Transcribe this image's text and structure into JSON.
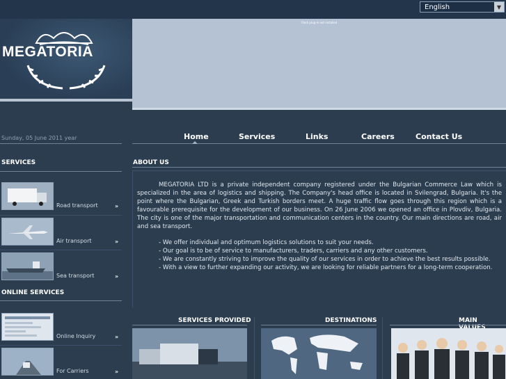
{
  "language": {
    "selected": "English"
  },
  "brand": {
    "name": "MEGATORIA"
  },
  "banner": {
    "message": "Flash plug-in not installed"
  },
  "date": "Sunday, 05 June 2011 year",
  "nav": [
    {
      "label": "Home"
    },
    {
      "label": "Services"
    },
    {
      "label": "Links"
    },
    {
      "label": "Careers"
    },
    {
      "label": "Contact Us"
    }
  ],
  "services": {
    "title": "SERVICES",
    "items": [
      {
        "label": "Road transport",
        "icon": "truck-photo"
      },
      {
        "label": "Air transport",
        "icon": "airplane-photo"
      },
      {
        "label": "Sea transport",
        "icon": "ship-photo"
      }
    ],
    "more_glyph": "»"
  },
  "online_services": {
    "title": "ONLINE SERVICES",
    "items": [
      {
        "label": "Online Inquiry",
        "icon": "form-screenshot"
      },
      {
        "label": "For Carriers",
        "icon": "road-photo"
      }
    ]
  },
  "about": {
    "title": "ABOUT US",
    "paragraph": "MEGATORIA LTD is a private independent company registered under the Bulgarian Commerce Law which is specialized in the area of logistics and shipping. The Company's head office is located in Svilengrad, Bulgaria. It's the point where the Bulgarian, Greek and Turkish borders meet. A huge traffic flow goes through this region which is a favourable prerequisite for the development of our business. On 26 June 2006 we opened an office in Plovdiv, Bulgaria. The city is one of the major transportation and communication centers in the country. Our main directions are road, air and sea transport.",
    "bullets": [
      "- We offer individual and optimum logistics solutions to suit your needs.",
      "- Our goal is to be of service to manufacturers, traders, carriers and any other customers.",
      "- We are constantly striving to improve the quality of our services in order to achieve the best results possible.",
      "- With a view to further expanding our activity, we are looking for reliable partners for a long-term cooperation."
    ]
  },
  "columns": [
    {
      "title": "SERVICES PROVIDED",
      "image": "trucks-photo"
    },
    {
      "title": "DESTINATIONS",
      "image": "world-map"
    },
    {
      "title": "MAIN VALUES",
      "image": "team-photo"
    }
  ],
  "colors": {
    "background": "#2b3d4f",
    "accent": "#b4c2d3"
  }
}
